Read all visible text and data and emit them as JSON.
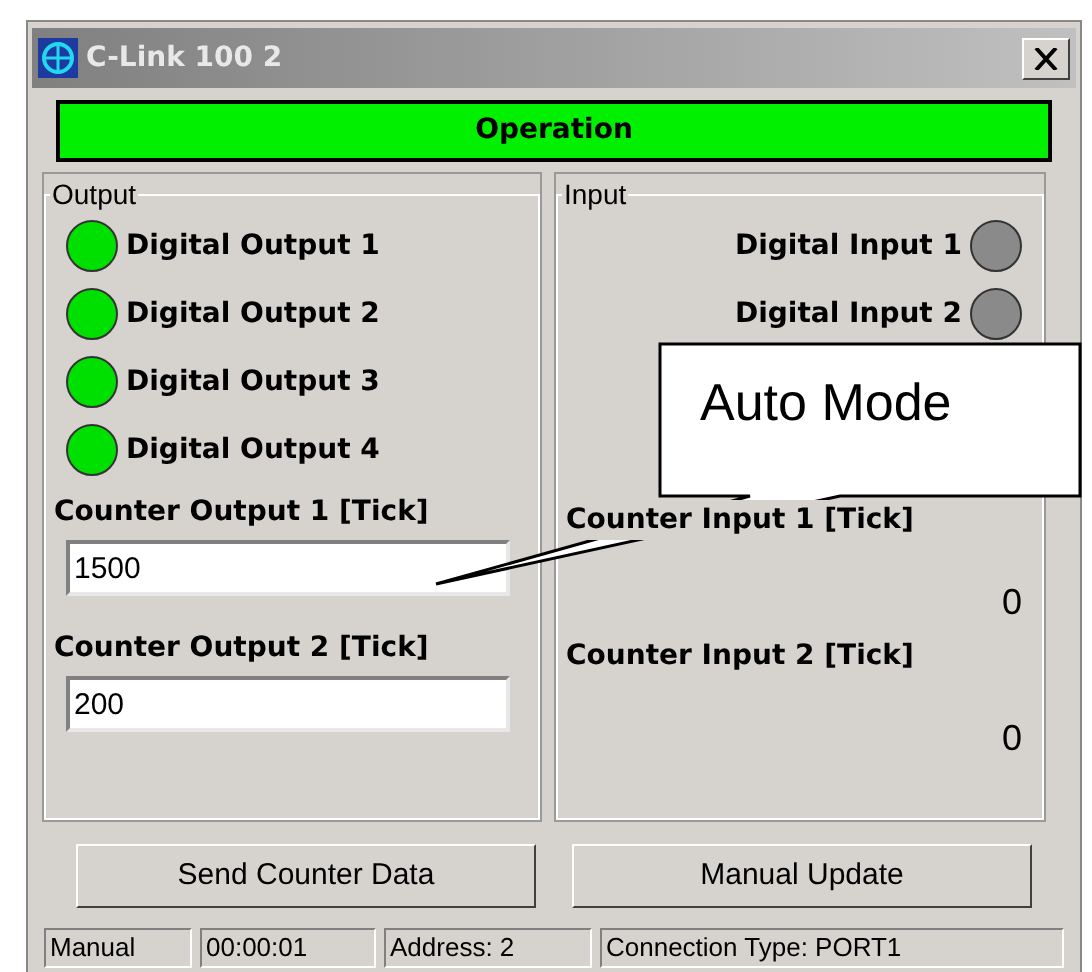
{
  "window": {
    "title": "C-Link 100 2"
  },
  "status_banner": "Operation",
  "output": {
    "legend": "Output",
    "digital": [
      {
        "label": "Digital Output 1",
        "on": true
      },
      {
        "label": "Digital Output 2",
        "on": true
      },
      {
        "label": "Digital Output 3",
        "on": true
      },
      {
        "label": "Digital Output 4",
        "on": true
      }
    ],
    "counters": [
      {
        "label": "Counter Output 1 [Tick]",
        "value": "1500"
      },
      {
        "label": "Counter Output 2 [Tick]",
        "value": "200"
      }
    ]
  },
  "input": {
    "legend": "Input",
    "digital": [
      {
        "label": "Digital Input 1",
        "on": false
      },
      {
        "label": "Digital Input 2",
        "on": false
      }
    ],
    "counters": [
      {
        "label": "Counter Input 1 [Tick]",
        "value": "0"
      },
      {
        "label": "Counter Input 2 [Tick]",
        "value": "0"
      }
    ]
  },
  "buttons": [
    "Send Counter Data",
    "Manual Update"
  ],
  "status_bar": [
    "Manual",
    "00:00:01",
    "Address: 2",
    "Connection Type: PORT1"
  ],
  "callout": "Auto Mode"
}
